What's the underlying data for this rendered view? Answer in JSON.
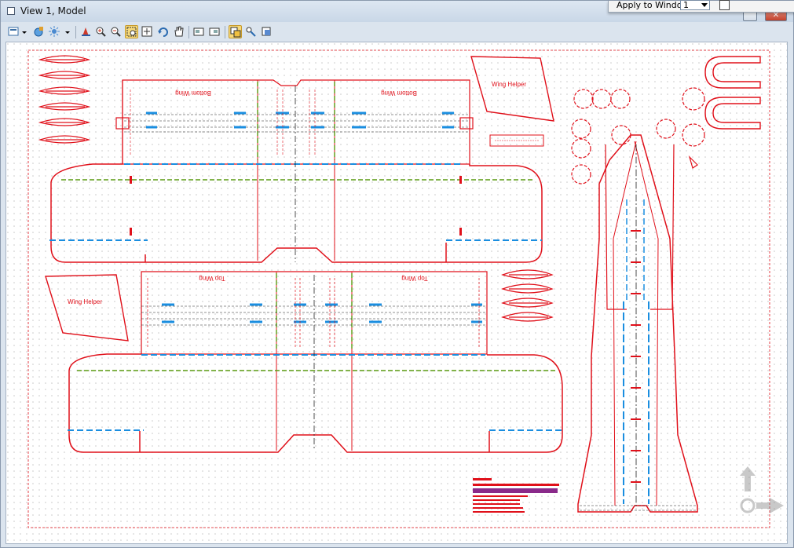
{
  "window": {
    "title": "View 1, Model"
  },
  "popup": {
    "apply_label": "Apply to Window:",
    "apply_value": "1"
  },
  "toolbar": {
    "items": [
      "view-display-icon",
      "dropdown-arrow-icon",
      "view-attributes-icon",
      "lighting-icon",
      "dropdown-arrow-icon",
      "update-view-icon",
      "zoom-in-icon",
      "zoom-out-icon",
      "window-area-icon",
      "fit-view-icon",
      "rotate-view-icon",
      "pan-view-icon",
      "view-previous-icon",
      "view-next-icon",
      "copy-view-icon",
      "clip-volume-icon",
      "view-toggle-icon"
    ]
  },
  "sheet": {
    "bottom_wing_label_left": "Bottom Wing",
    "bottom_wing_label_right": "Bottom Wing",
    "top_wing_label_left": "Top Wing",
    "top_wing_label_right": "Top Wing",
    "wing_helper_top": "Wing Helper",
    "wing_helper_bottom": "Wing Helper"
  },
  "colors": {
    "part_outline": "#e0101a",
    "fold_green": "#5a9a10",
    "tab_blue": "#1a8ee0",
    "center_black": "#222222",
    "grid_dot": "#c7c7c7"
  },
  "nav_cube": {
    "icons": [
      "up-arrow-icon",
      "right-arrow-icon",
      "center-icon"
    ]
  }
}
